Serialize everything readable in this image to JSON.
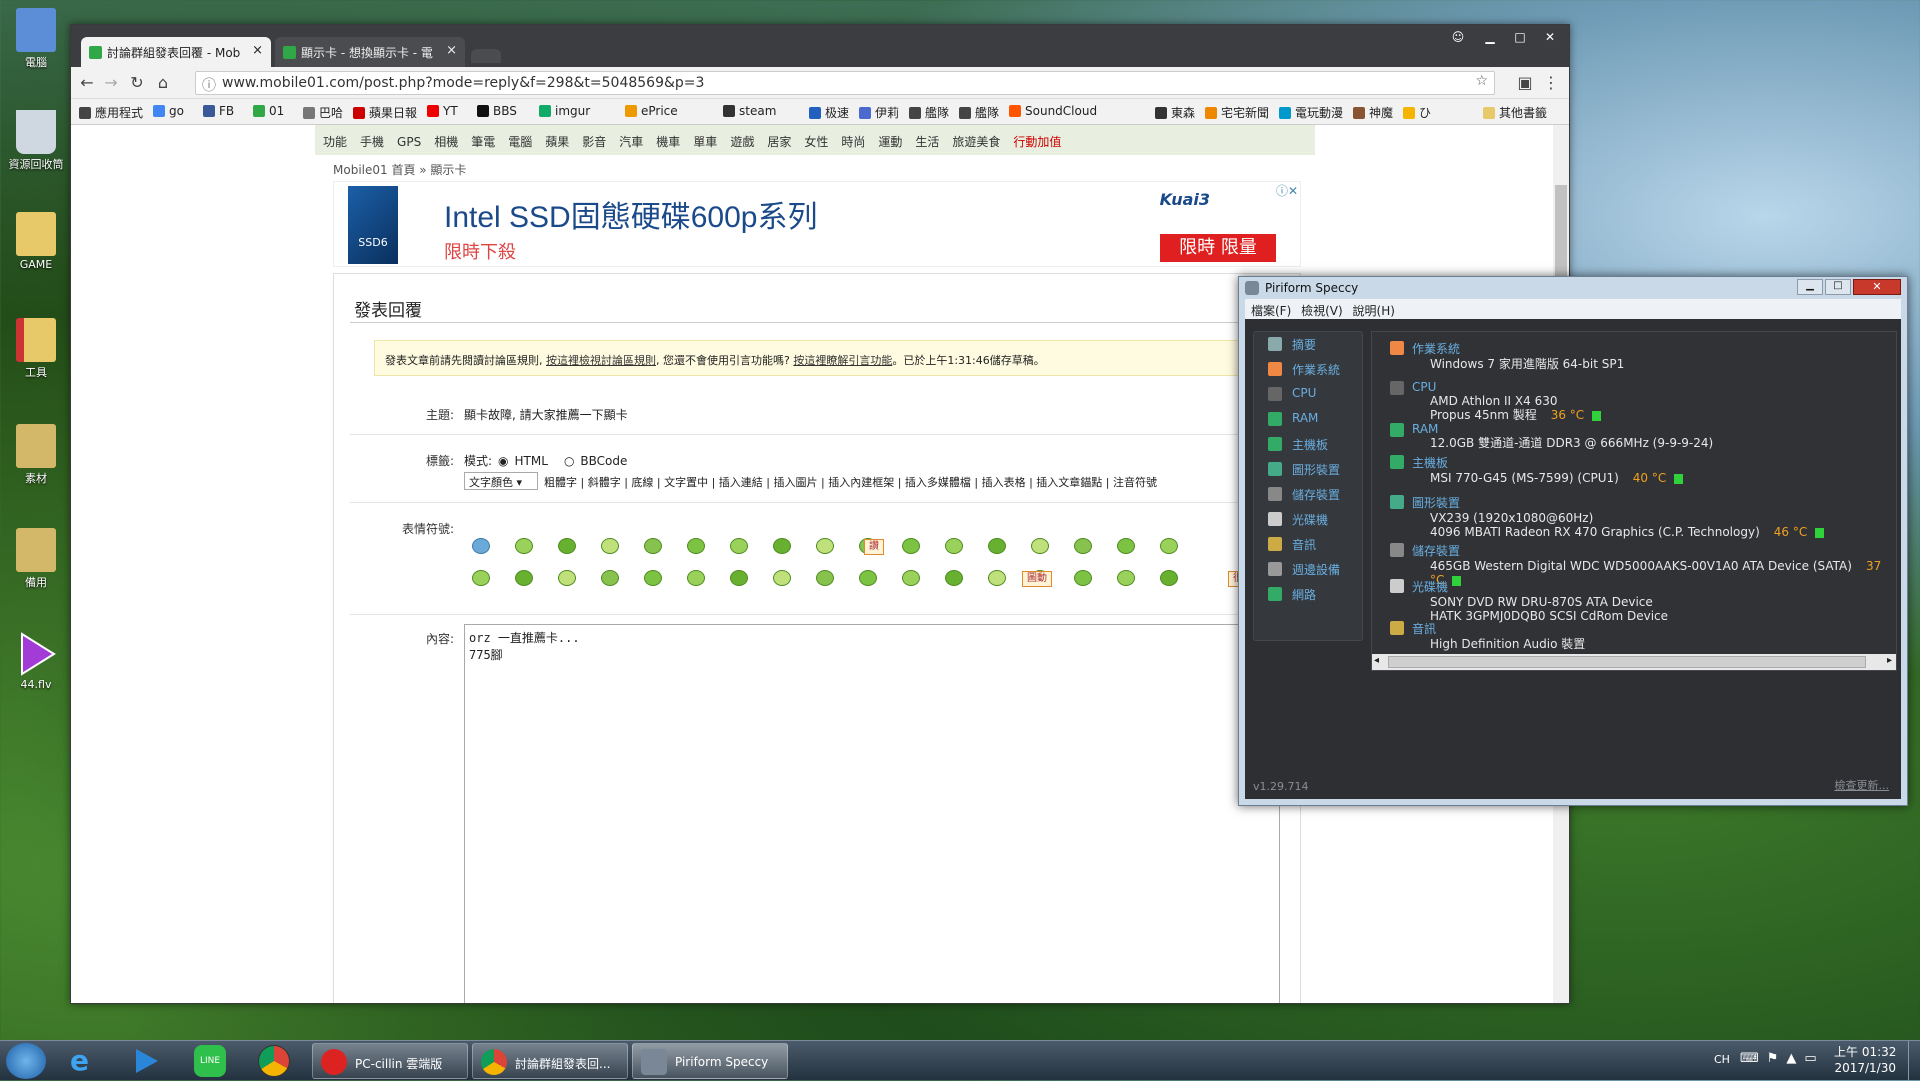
{
  "desktop": {
    "icons": [
      {
        "label": "電腦"
      },
      {
        "label": "資源回收筒"
      },
      {
        "label": "GAME"
      },
      {
        "label": "工具"
      },
      {
        "label": "素材"
      },
      {
        "label": "備用"
      },
      {
        "label": "44.flv"
      }
    ]
  },
  "browser": {
    "tabs": [
      {
        "title": "討論群組發表回覆 - Mob"
      },
      {
        "title": "顯示卡 - 想換顯示卡 - 電"
      }
    ],
    "url": "www.mobile01.com/post.php?mode=reply&f=298&t=5048569&p=3",
    "bookmarks": [
      "應用程式",
      "go",
      "FB",
      "01",
      "巴哈",
      "蘋果日報",
      "YT",
      "BBS",
      "imgur",
      "ePrice",
      "steam",
      "极速",
      "伊莉",
      "艦隊",
      "艦隊",
      "SoundCloud",
      "東森",
      "宅宅新聞",
      "電玩動漫",
      "神魔",
      "ひ",
      "其他書籤"
    ],
    "sitenav": [
      "功能",
      "手機",
      "GPS",
      "相機",
      "筆電",
      "電腦",
      "蘋果",
      "影音",
      "汽車",
      "機車",
      "單車",
      "遊戲",
      "居家",
      "女性",
      "時尚",
      "運動",
      "生活",
      "旅遊美食",
      "行動加值"
    ],
    "breadcrumb": "Mobile01 首頁 » 顯示卡",
    "ad": {
      "headline": "Intel SSD固態硬碟600p系列",
      "sub": "限時下殺",
      "badge": "限時 限量",
      "brand": "Kuai3"
    },
    "form": {
      "heading": "發表回覆",
      "notice_pre": "發表文章前請先閱讀討論區規則, ",
      "notice_link1": "按這裡檢視討論區規則",
      "notice_mid": ", 您還不會使用引言功能嗎? ",
      "notice_link2": "按這裡瞭解引言功能",
      "notice_post": "。已於上午1:31:46儲存草稿。",
      "subject_label": "主題:",
      "subject_value": "顯卡故障, 請大家推薦一下顯卡",
      "tag_label": "標籤:",
      "mode_label": "模式:",
      "mode_html": "HTML",
      "mode_bbcode": "BBCode",
      "color_select": "文字顏色",
      "format_links": "粗體字 | 斜體字 | 底線 | 文字置中 | 插入連結 | 插入圖片 | 插入內建框架 | 插入多媒體檔 | 插入表格 | 插入文章錨點 | 注音符號",
      "emoji_label": "表情符號:",
      "emoji_tags": [
        "讚",
        "圖動",
        "很潮"
      ],
      "content_label": "內容:",
      "content_value": "orz 一直推薦卡...\n775腳"
    }
  },
  "speccy": {
    "title": "Piriform Speccy",
    "menu": [
      "檔案(F)",
      "檢視(V)",
      "說明(H)"
    ],
    "sidebar": [
      "摘要",
      "作業系統",
      "CPU",
      "RAM",
      "主機板",
      "圖形裝置",
      "儲存裝置",
      "光碟機",
      "音訊",
      "週邊設備",
      "網路"
    ],
    "sections": [
      {
        "head": "作業系統",
        "lines": [
          "Windows 7 家用進階版 64-bit SP1"
        ],
        "temp": ""
      },
      {
        "head": "CPU",
        "lines": [
          "AMD Athlon II X4 630",
          "Propus 45nm 製程"
        ],
        "temp": "36 °C"
      },
      {
        "head": "RAM",
        "lines": [
          "12.0GB 雙通道-通道 DDR3 @ 666MHz (9-9-9-24)"
        ],
        "temp": ""
      },
      {
        "head": "主機板",
        "lines": [
          "MSI 770-G45 (MS-7599) (CPU1)"
        ],
        "temp": "40 °C"
      },
      {
        "head": "圖形裝置",
        "lines": [
          "VX239 (1920x1080@60Hz)",
          "4096 MBATI Radeon RX 470 Graphics (C.P. Technology)"
        ],
        "temp": "46 °C"
      },
      {
        "head": "儲存裝置",
        "lines": [
          "465GB Western Digital WDC WD5000AAKS-00V1A0 ATA Device (SATA)"
        ],
        "temp": "37 °C"
      },
      {
        "head": "光碟機",
        "lines": [
          "SONY DVD RW DRU-870S ATA Device",
          "HATK 3GPMJ0DQB0 SCSI CdRom Device"
        ],
        "temp": ""
      },
      {
        "head": "音訊",
        "lines": [
          "High Definition Audio 裝置"
        ],
        "temp": ""
      }
    ],
    "version": "v1.29.714",
    "update": "檢查更新..."
  },
  "taskbar": {
    "items": [
      {
        "label": "PC-cillin 雲端版"
      },
      {
        "label": "討論群組發表回..."
      },
      {
        "label": "Piriform Speccy"
      }
    ],
    "lang": "CH",
    "time": "上午 01:32",
    "date": "2017/1/30"
  }
}
